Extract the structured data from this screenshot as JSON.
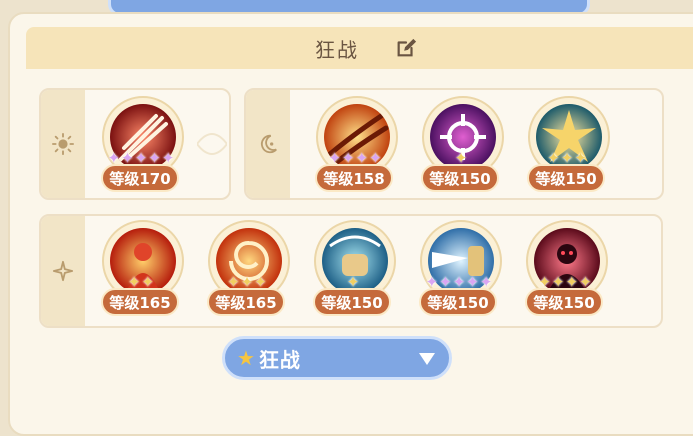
{
  "header": {
    "title": "狂战"
  },
  "groups": [
    {
      "id": "sun",
      "skills": [
        {
          "level": "等级170",
          "stars": 5,
          "star_color": "purple",
          "theme": "crimson-sword"
        }
      ]
    },
    {
      "id": "moon",
      "skills": [
        {
          "level": "等级158",
          "stars": 4,
          "star_color": "purple",
          "theme": "flame-slash"
        },
        {
          "level": "等级150",
          "stars": 1,
          "star_color": "gold",
          "theme": "magenta-target"
        },
        {
          "level": "等级150",
          "stars": 3,
          "star_color": "gold",
          "theme": "golden-burst"
        }
      ]
    },
    {
      "id": "spark",
      "skills": [
        {
          "level": "等级165",
          "stars": 2,
          "star_color": "gold",
          "theme": "fire-warrior"
        },
        {
          "level": "等级165",
          "stars": 3,
          "star_color": "gold",
          "theme": "fire-swirl"
        },
        {
          "level": "等级150",
          "stars": 1,
          "star_color": "gold",
          "theme": "blue-fist"
        },
        {
          "level": "等级150",
          "stars": 5,
          "star_color": "purple",
          "theme": "ice-charge"
        },
        {
          "level": "等级150",
          "stars": 4,
          "star_color": "gold",
          "theme": "red-demon"
        }
      ]
    }
  ],
  "dropdown": {
    "selected": "狂战"
  },
  "colors": {
    "accent_blue": "#7fa6e3",
    "level_badge": "#c56a3b",
    "star_gold": "#f1cf62",
    "star_purple": "#d9a6f2"
  }
}
